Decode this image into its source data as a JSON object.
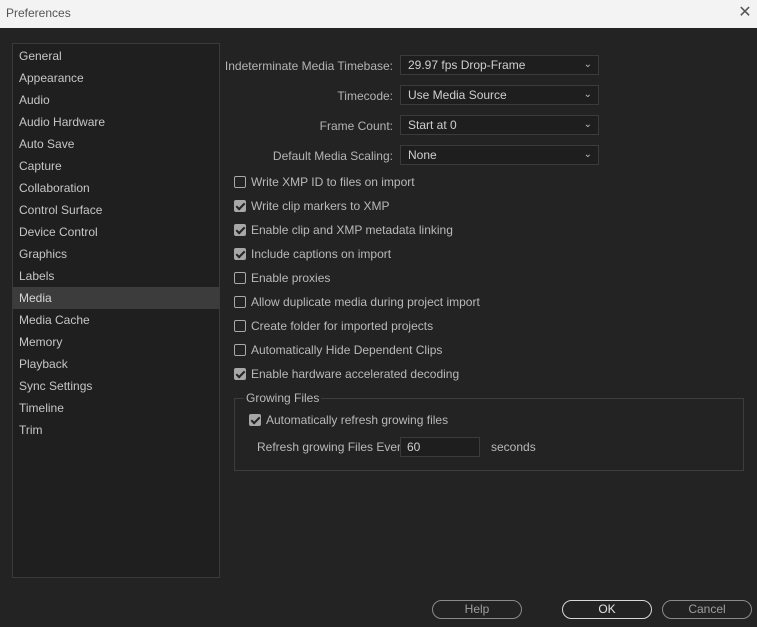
{
  "window": {
    "title": "Preferences",
    "close_glyph": "✕"
  },
  "sidebar": {
    "items": [
      {
        "label": "General"
      },
      {
        "label": "Appearance"
      },
      {
        "label": "Audio"
      },
      {
        "label": "Audio Hardware"
      },
      {
        "label": "Auto Save"
      },
      {
        "label": "Capture"
      },
      {
        "label": "Collaboration"
      },
      {
        "label": "Control Surface"
      },
      {
        "label": "Device Control"
      },
      {
        "label": "Graphics"
      },
      {
        "label": "Labels"
      },
      {
        "label": "Media"
      },
      {
        "label": "Media Cache"
      },
      {
        "label": "Memory"
      },
      {
        "label": "Playback"
      },
      {
        "label": "Sync Settings"
      },
      {
        "label": "Timeline"
      },
      {
        "label": "Trim"
      }
    ],
    "selected": "Media"
  },
  "media": {
    "timebase": {
      "label": "Indeterminate Media Timebase:",
      "value": "29.97 fps Drop-Frame"
    },
    "timecode": {
      "label": "Timecode:",
      "value": "Use Media Source"
    },
    "frame_count": {
      "label": "Frame Count:",
      "value": "Start at 0"
    },
    "scaling": {
      "label": "Default Media Scaling:",
      "value": "None"
    },
    "options": [
      {
        "label": "Write XMP ID to files on import",
        "checked": false
      },
      {
        "label": "Write clip markers to XMP",
        "checked": true
      },
      {
        "label": "Enable clip and XMP metadata linking",
        "checked": true
      },
      {
        "label": "Include captions on import",
        "checked": true
      },
      {
        "label": "Enable proxies",
        "checked": false
      },
      {
        "label": "Allow duplicate media during project import",
        "checked": false
      },
      {
        "label": "Create folder for imported projects",
        "checked": false
      },
      {
        "label": "Automatically Hide Dependent Clips",
        "checked": false
      },
      {
        "label": "Enable hardware accelerated decoding",
        "checked": true
      }
    ],
    "growing_files": {
      "title": "Growing Files",
      "auto_refresh_label": "Automatically refresh growing files",
      "auto_refresh_checked": true,
      "refresh_label": "Refresh growing Files Every",
      "refresh_value": "60",
      "refresh_unit": "seconds"
    }
  },
  "buttons": {
    "help": "Help",
    "ok": "OK",
    "cancel": "Cancel"
  },
  "icons": {
    "chevron": "chevron-down-icon",
    "check": "checkmark-icon",
    "close": "close-icon"
  },
  "colors": {
    "background": "#232323",
    "sidebar_selected": "#3c3c3c",
    "titlebar": "#f3f3f3"
  }
}
